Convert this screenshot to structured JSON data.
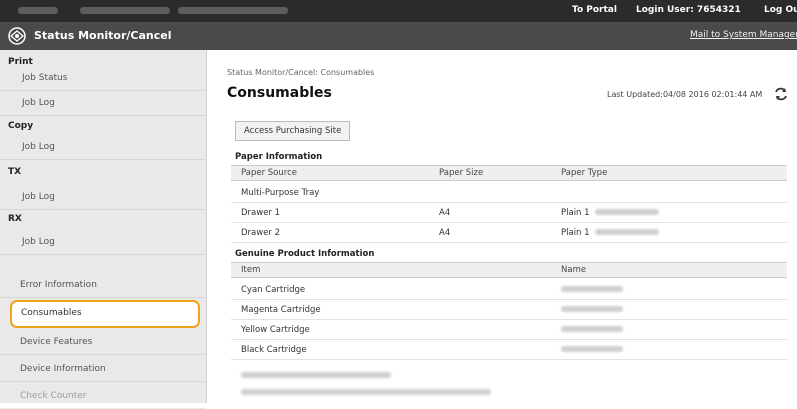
{
  "topbar": {
    "to_portal": "To Portal",
    "login_user": "Login User:  7654321",
    "logout": "Log Out"
  },
  "titlebar": {
    "title": "Status Monitor/Cancel",
    "mail": "Mail to System Manager"
  },
  "sidebar": {
    "print_head": "Print",
    "job_status": "Job Status",
    "job_log": "Job Log",
    "copy_head": "Copy",
    "tx_head": "TX",
    "rx_head": "RX",
    "error_info": "Error Information",
    "consumables": "Consumables",
    "device_features": "Device Features",
    "device_info": "Device Information",
    "check_counter": "Check Counter"
  },
  "main": {
    "breadcrumb": "Status Monitor/Cancel: Consumables",
    "title": "Consumables",
    "last_updated": "Last Updated:04/08 2016 02:01:44 AM",
    "access_button": "Access Purchasing Site",
    "paper_info_title": "Paper Information",
    "paper_headers": [
      "Paper Source",
      "Paper Size",
      "Paper Type"
    ],
    "paper_rows": [
      {
        "source": "Multi-Purpose Tray",
        "size": "",
        "type": ""
      },
      {
        "source": "Drawer 1",
        "size": "A4",
        "type": "Plain 1"
      },
      {
        "source": "Drawer 2",
        "size": "A4",
        "type": "Plain 1"
      }
    ],
    "genuine_title": "Genuine Product Information",
    "genuine_headers": [
      "Item",
      "Name"
    ],
    "genuine_rows": [
      "Cyan Cartridge",
      "Magenta Cartridge",
      "Yellow Cartridge",
      "Black Cartridge"
    ]
  }
}
